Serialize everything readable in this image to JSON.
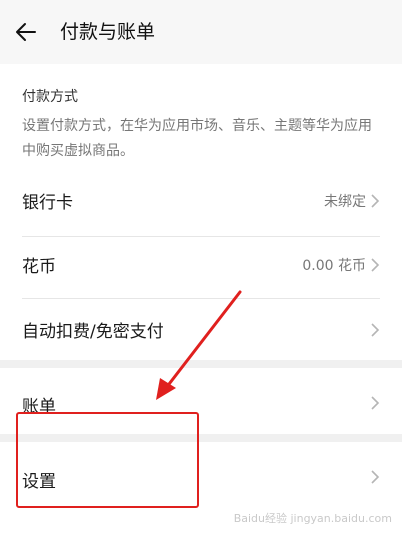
{
  "header": {
    "title": "付款与账单",
    "back_icon": "arrow-left-icon"
  },
  "payment_section": {
    "heading": "付款方式",
    "description": "设置付款方式，在华为应用市场、音乐、主题等华为应用中购买虚拟商品。"
  },
  "rows": {
    "bank_card": {
      "label": "银行卡",
      "value": "未绑定"
    },
    "huabi": {
      "label": "花币",
      "value": "0.00 花币"
    },
    "auto_pay": {
      "label": "自动扣费/免密支付"
    },
    "bill": {
      "label": "账单"
    },
    "settings": {
      "label": "设置"
    }
  },
  "annotation": {
    "color": "#e0201e"
  },
  "watermark": "Baidu经验 jingyan.baidu.com"
}
